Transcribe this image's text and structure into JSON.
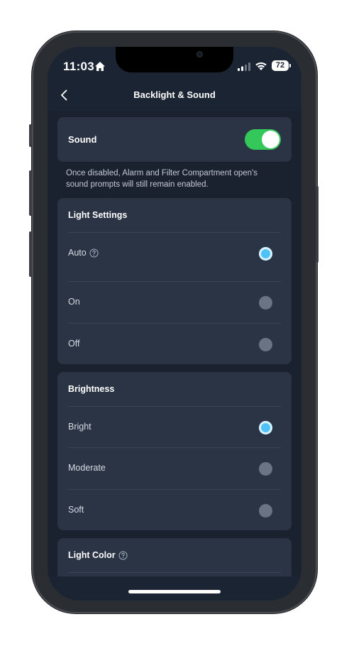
{
  "status_bar": {
    "time": "11:03",
    "battery": "72"
  },
  "nav": {
    "title": "Backlight & Sound",
    "back_icon": "chevron-left-icon"
  },
  "sound": {
    "label": "Sound",
    "enabled": true,
    "note": "Once disabled, Alarm and Filter Compartment open's sound prompts will still remain enabled."
  },
  "light_settings": {
    "title": "Light Settings",
    "options": [
      {
        "label": "Auto",
        "selected": true,
        "help": true
      },
      {
        "label": "On",
        "selected": false
      },
      {
        "label": "Off",
        "selected": false
      }
    ]
  },
  "brightness": {
    "title": "Brightness",
    "options": [
      {
        "label": "Bright",
        "selected": true
      },
      {
        "label": "Moderate",
        "selected": false
      },
      {
        "label": "Soft",
        "selected": false
      }
    ]
  },
  "light_color": {
    "title": "Light Color"
  },
  "colors": {
    "accent": "#4fc3f7",
    "toggle_on": "#34c759",
    "background": "#1b2433",
    "card": "#2a3445"
  }
}
